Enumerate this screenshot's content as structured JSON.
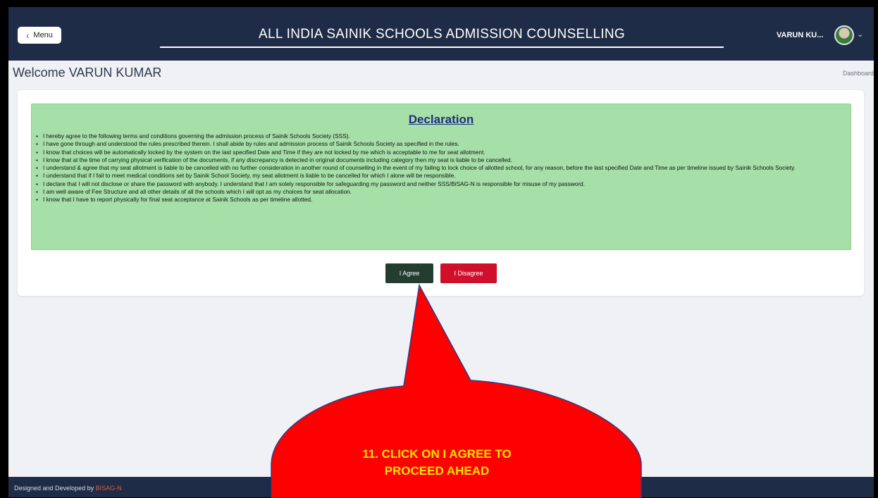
{
  "header": {
    "menu_label": "Menu",
    "title": "ALL INDIA SAINIK SCHOOLS ADMISSION COUNSELLING",
    "user_name": "VARUN KU..."
  },
  "page": {
    "welcome": "Welcome VARUN KUMAR",
    "breadcrumb": "Dashboard"
  },
  "declaration": {
    "title": "Declaration",
    "items": [
      "I hereby agree to the following terms and conditions governing the admission process of Sainik Schools Society (SSS).",
      "I have gone through and understood the rules prescribed therein. I shall abide by rules and admission process of Sainik Schools Society as specified in the rules.",
      "I know that choices will be automatically locked by the system on the last specified Date and Time if they are not locked by me which is acceptable to me for seat allotment.",
      "I know that at the time of carrying physical verification of the documents, if any discrepancy is detected in original documents including category then my seat is liable to be cancelled.",
      "I understand & agree that my seat allotment is liable to be cancelled with no further consideration in another round of counselling in the event of my failing to lock choice of allotted school, for any reason, before the last specified Date and Time as per timeline issued by Sainik Schools Society.",
      "I understand that if I fail to meet medical conditions set by Sainik School Society, my seat allotment is liable to be cancelled for which I alone will be responsible.",
      "I declare that I will not disclose or share the password with anybody. I understand that I am solely responsible for safeguarding my password and neither SSS/BiSAG-N is responsible for misuse of my password.",
      "I am well aware of Fee Structure and all other details of all the schools which I will opt as my choices for seat allocation.",
      "I know that I have to report physically for final seat acceptance at Sainik Schools as per timeline allotted."
    ],
    "agree_label": "I Agree",
    "disagree_label": "I Disagree"
  },
  "footer": {
    "prefix": "Designed and Developed by ",
    "brand": "BISAG-N"
  },
  "annotation": {
    "line1": "11. CLICK ON I AGREE TO",
    "line2": "PROCEED AHEAD"
  },
  "colors": {
    "navbar": "#1f2c47",
    "declaration_bg": "#a6dfa8",
    "agree_button": "#243d31",
    "disagree_button": "#d0102a",
    "callout_fill": "#ff0000",
    "callout_text": "#ffe600"
  }
}
